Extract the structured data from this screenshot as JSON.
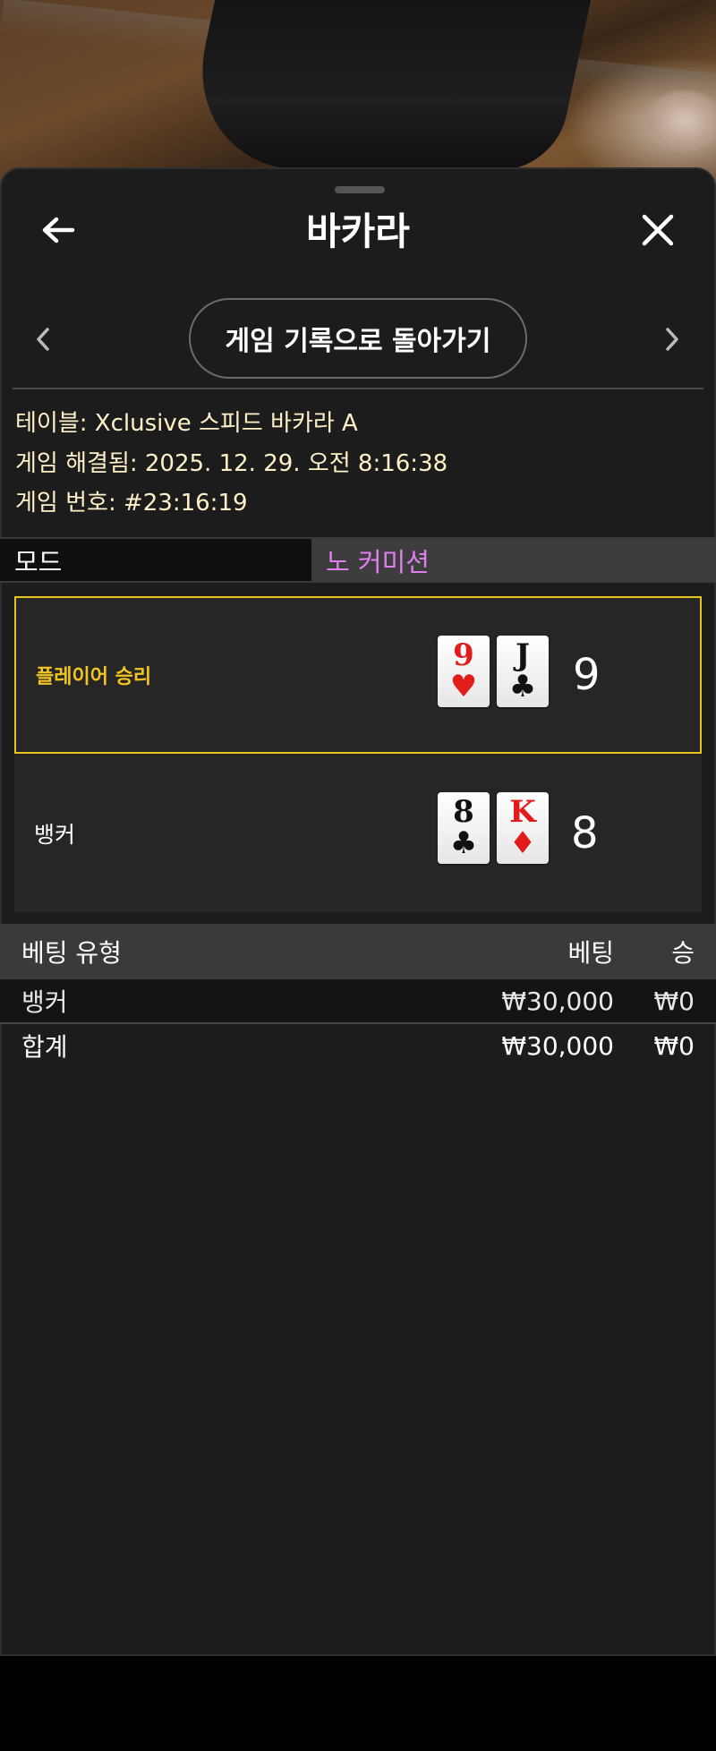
{
  "header": {
    "title": "바카라",
    "back_icon": "arrow-left-icon",
    "close_icon": "close-icon"
  },
  "nav": {
    "back_to_history_label": "게임 기록으로 돌아가기",
    "prev_icon": "chevron-left-icon",
    "next_icon": "chevron-right-icon"
  },
  "info": {
    "table": "테이블: Xclusive 스피드 바카라 A",
    "resolved": "게임 해결됨: 2025. 12. 29. 오전 8:16:38",
    "game_number": "게임 번호: #23:16:19"
  },
  "mode": {
    "label": "모드",
    "value": "노 커미션"
  },
  "player": {
    "label": "플레이어 승리",
    "cards": [
      {
        "rank": "9",
        "suit": "♥",
        "color": "red"
      },
      {
        "rank": "J",
        "suit": "♣",
        "color": "black"
      }
    ],
    "total": "9"
  },
  "banker": {
    "label": "뱅커",
    "cards": [
      {
        "rank": "8",
        "suit": "♣",
        "color": "black"
      },
      {
        "rank": "K",
        "suit": "♦",
        "color": "red"
      }
    ],
    "total": "8"
  },
  "bets": {
    "headers": {
      "type": "베팅 유형",
      "bet": "베팅",
      "win": "승"
    },
    "rows": [
      {
        "type": "뱅커",
        "bet": "₩30,000",
        "win": "₩0"
      }
    ],
    "total": {
      "type": "합계",
      "bet": "₩30,000",
      "win": "₩0"
    }
  },
  "colors": {
    "winner_border": "#e6c31c",
    "winner_label": "#f2c521",
    "mode_value": "#e07ef0",
    "info_text": "#fff0c8"
  }
}
